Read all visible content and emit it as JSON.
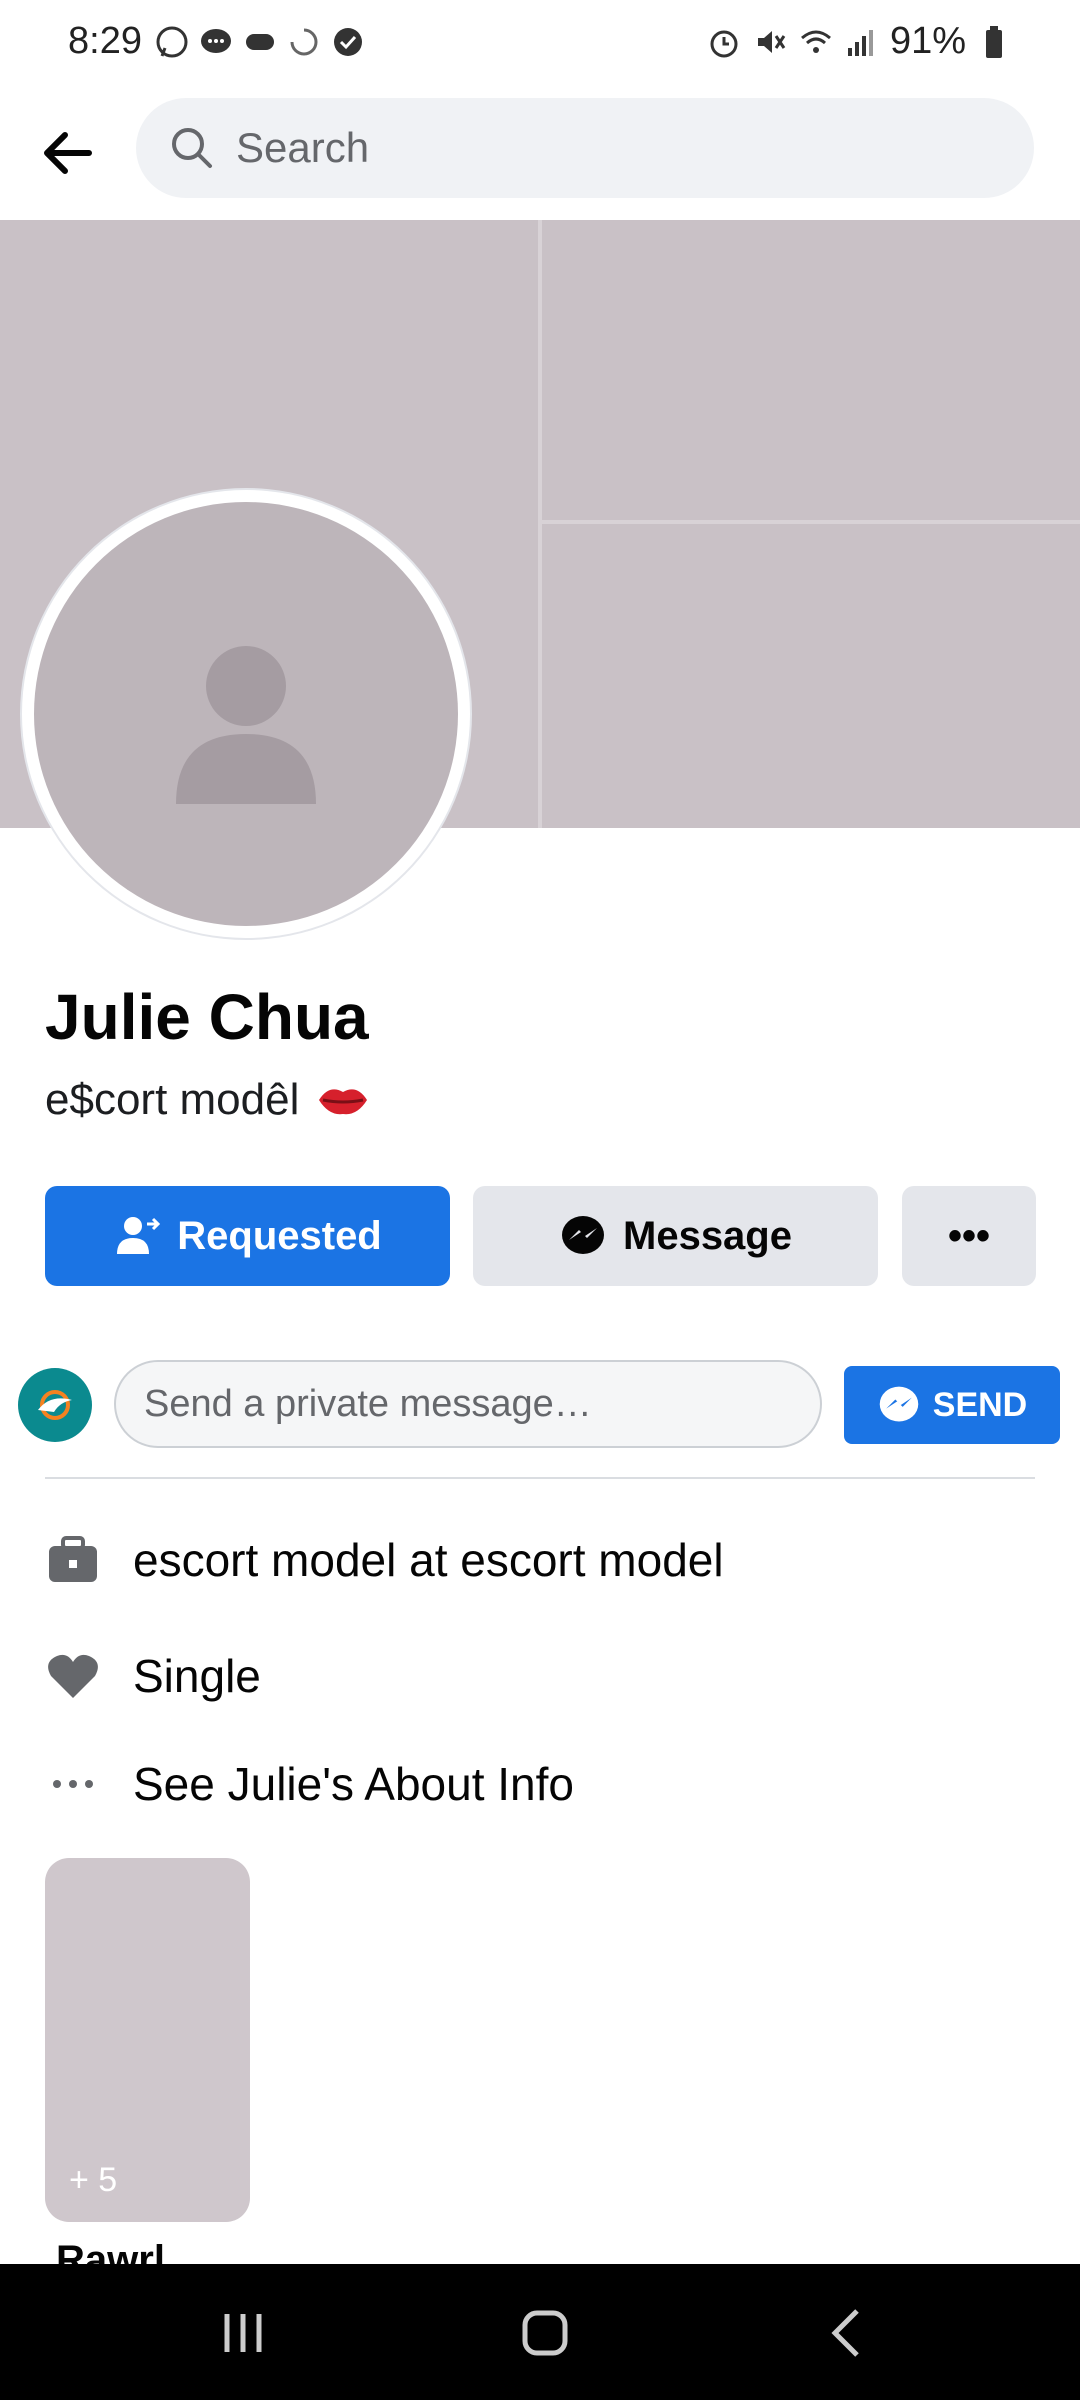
{
  "status_bar": {
    "time": "8:29",
    "battery": "91%",
    "left_icons": [
      "whatsapp-icon",
      "messenger-bubble-icon",
      "game-controller-icon",
      "loading-icon",
      "check-circle-icon"
    ],
    "right_icons": [
      "alarm-icon",
      "mute-icon",
      "wifi-icon",
      "signal-icon",
      "battery-icon"
    ]
  },
  "top_nav": {
    "search_placeholder": "Search"
  },
  "profile": {
    "name": "Julie Chua",
    "bio": "e$cort modêl",
    "bio_emoji": "lips-icon"
  },
  "actions": {
    "requested_label": "Requested",
    "message_label": "Message",
    "more_label": "•••"
  },
  "private_message": {
    "placeholder": "Send a private message…",
    "send_label": "SEND"
  },
  "about": {
    "items": [
      {
        "icon": "briefcase-icon",
        "label": "escort model at escort model"
      },
      {
        "icon": "heart-icon",
        "label": "Single"
      },
      {
        "icon": "more-dots-icon",
        "label": "See Julie's About Info"
      }
    ]
  },
  "story": {
    "count": "+ 5",
    "label": "Rawrl"
  },
  "colors": {
    "primary": "#1b74e4",
    "secondary_button": "#e4e6eb",
    "nav_bar": "#000000"
  }
}
